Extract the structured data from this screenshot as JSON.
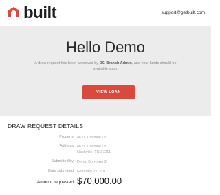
{
  "header": {
    "logo_text": "built",
    "support_email": "support@getbuilt.com"
  },
  "hero": {
    "title": "Hello Demo",
    "message_pre": "A draw request has been approved by",
    "approver": "DG Branch Admin",
    "message_post": ", and your funds should be available soon.",
    "button_label": "VIEW LOAN"
  },
  "details": {
    "title": "DRAW REQUEST DETAILS",
    "rows": [
      {
        "label": "Property",
        "value": "4621 Truxdale Dr"
      },
      {
        "label": "Address",
        "value": "4621 Truxdale Dr",
        "value2": "Nashville, TN 37211"
      },
      {
        "label": "Submitted by",
        "value": "Demo Borrower 2"
      },
      {
        "label": "Date submitted",
        "value": "February 27, 2017"
      },
      {
        "label": "Amount requested",
        "value": "$70,000.00"
      }
    ]
  },
  "colors": {
    "brand": "#d8493e",
    "hero_bg": "#ececec"
  },
  "icons": [
    "built-logo-icon"
  ]
}
